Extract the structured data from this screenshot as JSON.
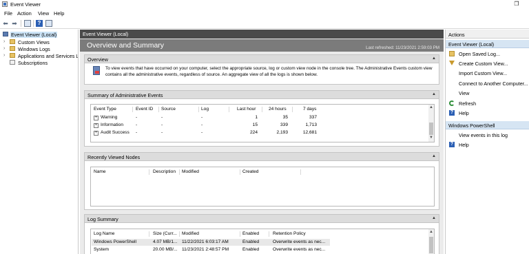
{
  "window": {
    "title": "Event Viewer",
    "maximize_glyph": "❐",
    "close_glyph": "✕"
  },
  "menu": [
    "File",
    "Action",
    "View",
    "Help"
  ],
  "tree": [
    {
      "label": "Event Viewer (Local)",
      "icon": "computer-icon",
      "selected": true
    },
    {
      "label": "Custom Views",
      "icon": "folder-icon"
    },
    {
      "label": "Windows Logs",
      "icon": "folder-icon"
    },
    {
      "label": "Applications and Services Lo",
      "icon": "folder-icon"
    },
    {
      "label": "Subscriptions",
      "icon": "log-icon"
    }
  ],
  "center": {
    "header": "Event Viewer (Local)",
    "overview_title": "Overview and Summary",
    "last_refreshed": "Last refreshed: 11/23/2021 2:59:03 PM",
    "overview": {
      "heading": "Overview",
      "text": "To view events that have occurred on your computer, select the appropriate source, log or custom view node in the console tree. The Administrative Events custom view contains all the administrative events, regardless of source. An aggregate view of all the logs is shown below."
    },
    "summary": {
      "heading": "Summary of Administrative Events",
      "columns": [
        "Event Type",
        "Event ID",
        "Source",
        "Log",
        "Last hour",
        "24 hours",
        "7 days"
      ],
      "rows": [
        {
          "type": "Warning",
          "id": "-",
          "source": "-",
          "log": "-",
          "hour": "1",
          "day": "35",
          "week": "337"
        },
        {
          "type": "Information",
          "id": "-",
          "source": "-",
          "log": "-",
          "hour": "15",
          "day": "339",
          "week": "1,713"
        },
        {
          "type": "Audit Success",
          "id": "-",
          "source": "-",
          "log": "-",
          "hour": "224",
          "day": "2,193",
          "week": "12,681"
        }
      ]
    },
    "recent": {
      "heading": "Recently Viewed Nodes",
      "columns": [
        "Name",
        "Description",
        "Modified",
        "Created"
      ]
    },
    "logsummary": {
      "heading": "Log Summary",
      "columns": [
        "Log Name",
        "Size (Curr...",
        "Modified",
        "Enabled",
        "Retention Policy"
      ],
      "rows": [
        {
          "name": "Windows PowerShell",
          "size": "4.07 MB/1...",
          "modified": "11/22/2021 6:03:17 AM",
          "enabled": "Enabled",
          "policy": "Overwrite events as nec..."
        },
        {
          "name": "System",
          "size": "20.00 MB/...",
          "modified": "11/23/2021 2:48:57 PM",
          "enabled": "Enabled",
          "policy": "Overwrite events as nec..."
        }
      ]
    }
  },
  "actions": {
    "heading": "Actions",
    "group1": "Event Viewer (Local)",
    "items1": [
      "Open Saved Log...",
      "Create Custom View...",
      "Import Custom View...",
      "Connect to Another Computer...",
      "View",
      "Refresh",
      "Help"
    ],
    "group2": "Windows PowerShell",
    "items2": [
      "View events in this log",
      "Help"
    ]
  }
}
